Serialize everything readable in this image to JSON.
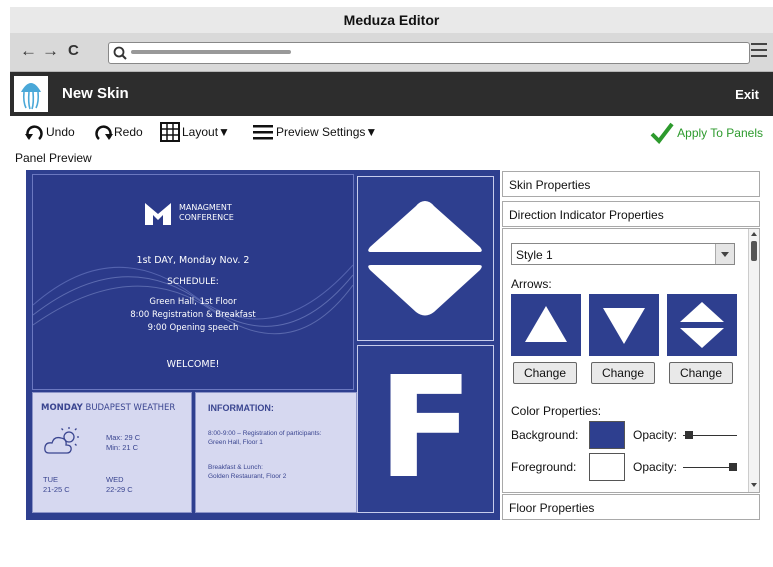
{
  "window": {
    "title": "Meduza Editor"
  },
  "browser": {
    "back": "←",
    "forward": "→",
    "reload": "C"
  },
  "app": {
    "title": "New Skin",
    "exit": "Exit"
  },
  "toolbar": {
    "undo": "Undo",
    "redo": "Redo",
    "layout": "Layout▼",
    "preview": "Preview Settings▼",
    "apply": "Apply To Panels"
  },
  "preview_label": "Panel Preview",
  "slide": {
    "org1": "MANAGMENT",
    "org2": "CONFERENCE",
    "day": "1st DAY, Monday Nov. 2",
    "schedule": "SCHEDULE:",
    "line1": "Green Hall, 1st Floor",
    "line2": "8:00 Registration & Breakfast",
    "line3": "9:00 Opening speech",
    "welcome": "WELCOME!"
  },
  "weather": {
    "day": "MONDAY",
    "city": "BUDAPEST WEATHER",
    "max": "Max: 29 C",
    "min": "Min: 21 C",
    "d1": "TUE",
    "d1t": "21-25 C",
    "d2": "WED",
    "d2t": "22-29 C"
  },
  "info": {
    "title": "INFORMATION:",
    "p1a": "8:00-9:00 – Registration of participants:",
    "p1b": "Green Hall, Floor 1",
    "p2a": "Breakfast & Lunch:",
    "p2b": "Golden Restaurant, Floor 2"
  },
  "floor_letter": "F",
  "side": {
    "skin": "Skin Properties",
    "direction": "Direction Indicator Properties",
    "style": "Style 1",
    "arrows": "Arrows:",
    "change": "Change",
    "color_props": "Color Properties:",
    "background": "Background:",
    "foreground": "Foreground:",
    "opacity": "Opacity:",
    "floor": "Floor Properties"
  },
  "colors": {
    "accent": "#2e3f8f",
    "apply": "#2d9a2d",
    "appbar": "#2d2d2d"
  },
  "values": {
    "background_opacity": 0.05,
    "foreground_opacity": 0.95
  }
}
